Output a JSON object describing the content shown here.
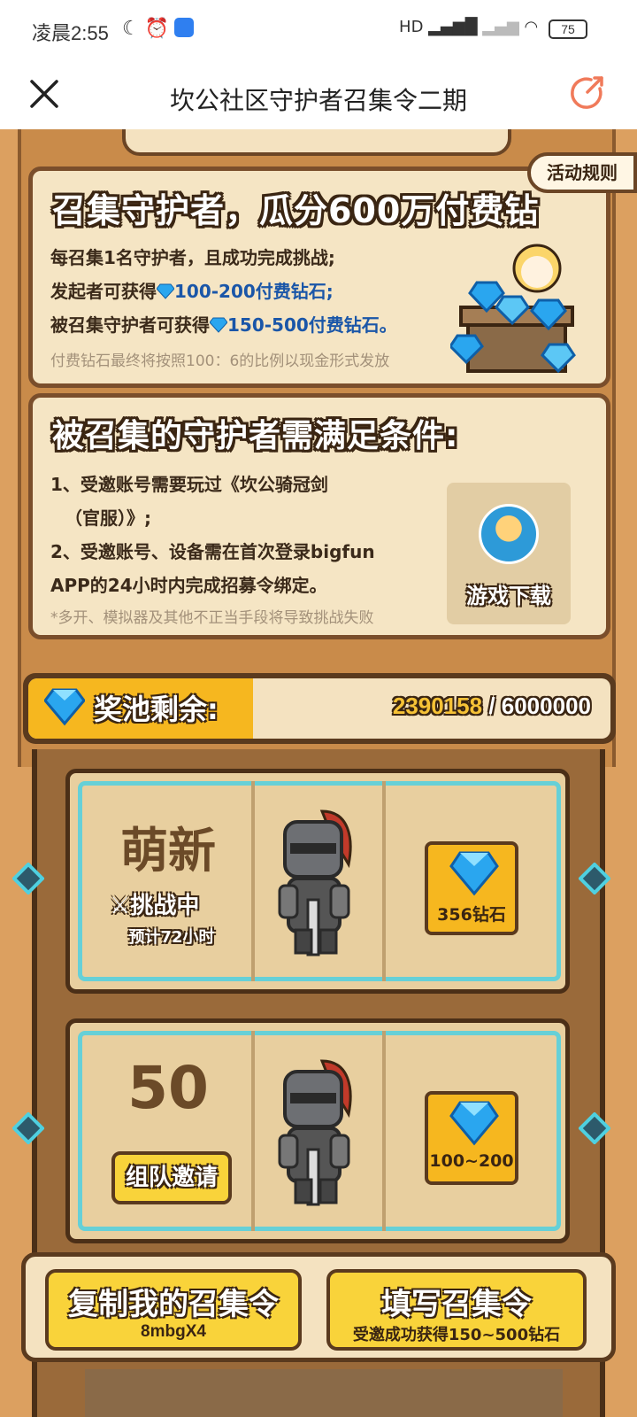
{
  "status_bar": {
    "time": "凌晨2:55",
    "signal_label": "HD",
    "battery": "75"
  },
  "title_bar": {
    "title": "坎公社区守护者召集令二期"
  },
  "rules_tab": "活动规则",
  "intro_card": {
    "heading": "召集守护者，瓜分600万付费钻",
    "line1": "每召集1名守护者，且成功完成挑战;",
    "line2_prefix": "发起者可获得",
    "line2_highlight": "100-200付费钻石;",
    "line3_prefix": "被召集守护者可获得",
    "line3_highlight": "150-500付费钻石。",
    "note": "付费钻石最终将按照100：6的比例以现金形式发放"
  },
  "requirements_card": {
    "heading": "被召集的守护者需满足条件:",
    "item1a": "1、受邀账号需要玩过《坎公骑冠剑",
    "item1b": "（官服）》;",
    "item2a": "2、受邀账号、设备需在首次登录bigfun",
    "item2b": "APP的24小时内完成招募令绑定。",
    "note": "*多开、模拟器及其他不正当手段将导致挑战失败",
    "download_label": "游戏下载"
  },
  "prize_pool": {
    "label": "奖池剩余:",
    "remaining": "2390158",
    "separator": " / ",
    "total": "6000000"
  },
  "rows": [
    {
      "rank": "萌新",
      "status": "挑战中",
      "eta": "预计72小时",
      "reward": "356钻石"
    },
    {
      "rank": "50",
      "button": "组队邀请",
      "reward": "100~200"
    }
  ],
  "bottom_bar": {
    "copy_title": "复制我的召集令",
    "copy_code": "8mbgX4",
    "fill_title": "填写召集令",
    "fill_sub": "受邀成功获得150~500钻石"
  },
  "colors": {
    "accent_gold": "#f6b71f",
    "wood_dark": "#4b2f17",
    "diamond_blue": "#2aa6ef",
    "share_icon": "#f07a5a"
  }
}
